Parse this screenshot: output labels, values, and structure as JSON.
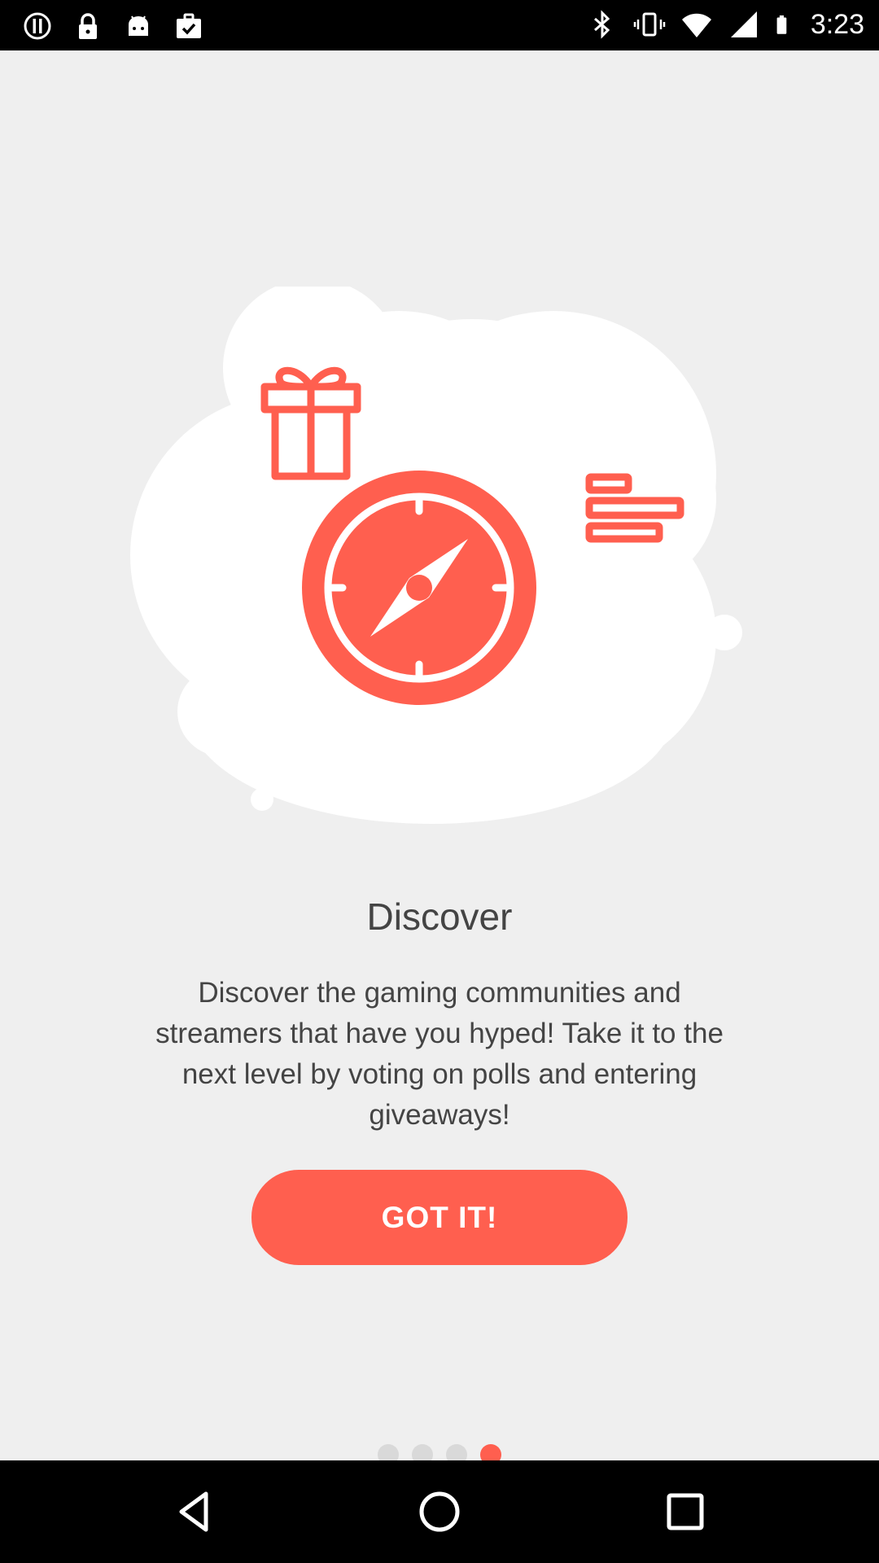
{
  "status_bar": {
    "time": "3:23",
    "left_icons": [
      "info-icon",
      "lock-icon",
      "android-icon",
      "briefcase-check-icon"
    ],
    "right_icons": [
      "bluetooth-icon",
      "vibrate-icon",
      "wifi-icon",
      "signal-icon",
      "battery-icon"
    ]
  },
  "onboarding": {
    "title": "Discover",
    "description": "Discover the gaming communities and streamers that have you hyped! Take it to the next level by voting on polls and entering giveaways!",
    "button_label": "GOT IT!",
    "page_indicator": {
      "total": 4,
      "active": 4
    }
  },
  "colors": {
    "accent": "#ff5f4f",
    "background": "#efefef",
    "text": "#444444",
    "dot_inactive": "#d9d9d9"
  },
  "nav_bar": {
    "buttons": [
      "back-icon",
      "home-icon",
      "recents-icon"
    ]
  }
}
